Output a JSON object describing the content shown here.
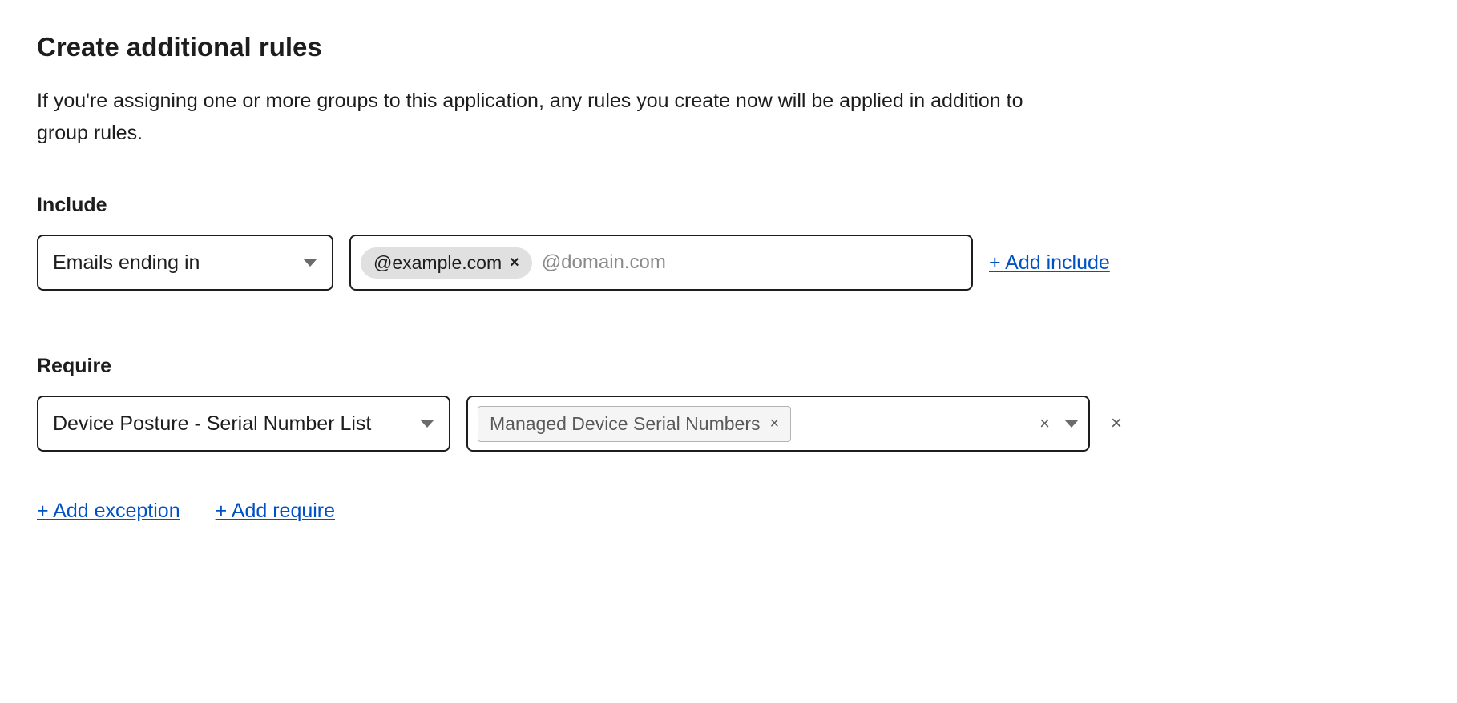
{
  "header": {
    "title": "Create additional rules",
    "description": "If you're assigning one or more groups to this application, any rules you create now will be applied in addition to group rules."
  },
  "include": {
    "label": "Include",
    "selector_value": "Emails ending in",
    "tags": [
      {
        "text": "@example.com"
      }
    ],
    "placeholder": "@domain.com",
    "add_link": "+ Add include"
  },
  "require": {
    "label": "Require",
    "selector_value": "Device Posture - Serial Number List",
    "tags": [
      {
        "text": "Managed Device Serial Numbers"
      }
    ]
  },
  "footer": {
    "add_exception": "+ Add exception",
    "add_require": "+ Add require"
  }
}
